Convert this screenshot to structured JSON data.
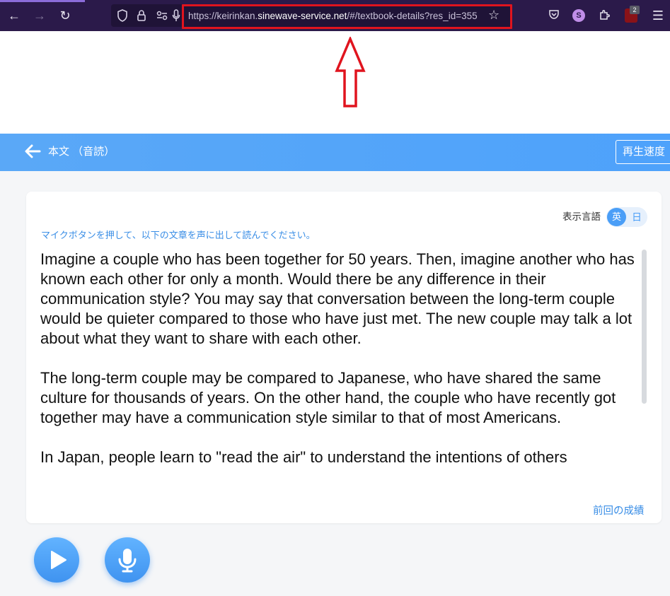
{
  "browser": {
    "back_icon": "back-arrow-icon",
    "url_prefix": "https://keirinkan.",
    "url_domain": "sinewave-service.net",
    "url_suffix": "/#/textbook-details?res_id=355",
    "profile_letter": "S",
    "ublock_count": "2",
    "highlight_color": "#e0141e"
  },
  "header": {
    "title": "本文 （音読）",
    "speed_button": "再生速度",
    "color": "#4ea2fb"
  },
  "card": {
    "language_label": "表示言語",
    "lang_en": "英",
    "lang_ja": "日",
    "instruction": "マイクボタンを押して、以下の文章を声に出して読んでください。",
    "paragraphs": [
      "Imagine a couple who has been together for 50 years.  Then, imagine another who has known each other for only a month.  Would there be any difference in their communication style?  You may say that conversation between the long-term couple would be quieter compared to those who have just met.  The new couple may talk a lot about what they want to share with each other.",
      "The long-term couple may be compared to Japanese, who have shared the same culture for thousands of years.  On the other hand, the couple who have recently got together may have a communication style similar to that of most Americans.",
      "In Japan, people learn to \"read the air\" to understand the intentions of others"
    ],
    "prev_results": "前回の成績"
  },
  "controls": {
    "play_icon": "play-icon",
    "mic_icon": "microphone-icon"
  }
}
